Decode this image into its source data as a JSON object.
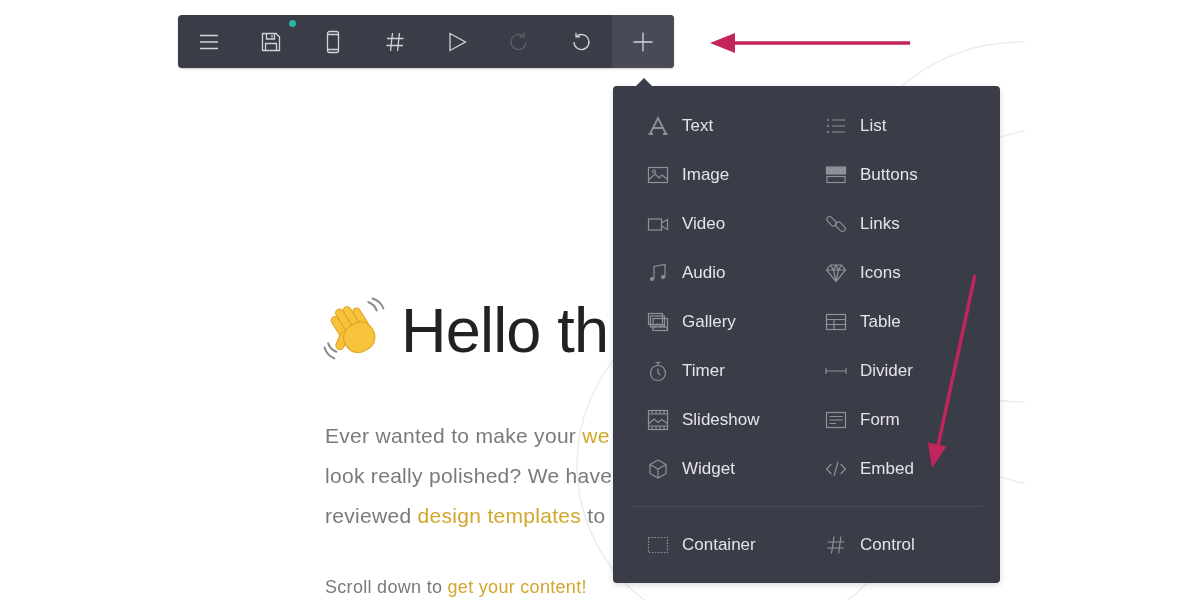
{
  "toolbar": {
    "buttons": [
      {
        "selected": false,
        "disabled": false,
        "dot": false
      },
      {
        "selected": false,
        "disabled": false,
        "dot": true
      },
      {
        "selected": false,
        "disabled": false,
        "dot": false
      },
      {
        "selected": false,
        "disabled": false,
        "dot": false
      },
      {
        "selected": false,
        "disabled": false,
        "dot": false
      },
      {
        "selected": false,
        "disabled": true,
        "dot": false
      },
      {
        "selected": false,
        "disabled": false,
        "dot": false
      },
      {
        "selected": true,
        "disabled": false,
        "dot": false
      }
    ]
  },
  "heading": "Hello th",
  "intro": {
    "lines": [
      [
        {
          "kind": "text",
          "text": "Ever wanted to make your "
        },
        {
          "kind": "link",
          "text": "we"
        }
      ],
      [
        {
          "kind": "text",
          "text": "look really polished? We have"
        }
      ],
      [
        {
          "kind": "text",
          "text": "reviewed "
        },
        {
          "kind": "link",
          "text": "design templates"
        },
        {
          "kind": "text",
          "text": " to"
        }
      ]
    ]
  },
  "scroll_hint": [
    {
      "kind": "text",
      "text": "Scroll down to "
    },
    {
      "kind": "link",
      "text": "get your content!"
    }
  ],
  "insert_menu": {
    "items": [
      {
        "label": "Text"
      },
      {
        "label": "List"
      },
      {
        "label": "Image"
      },
      {
        "label": "Buttons"
      },
      {
        "label": "Video"
      },
      {
        "label": "Links"
      },
      {
        "label": "Audio"
      },
      {
        "label": "Icons"
      },
      {
        "label": "Gallery"
      },
      {
        "label": "Table"
      },
      {
        "label": "Timer"
      },
      {
        "label": "Divider"
      },
      {
        "label": "Slideshow"
      },
      {
        "label": "Form"
      },
      {
        "label": "Widget"
      },
      {
        "label": "Embed"
      }
    ],
    "footer_items": [
      {
        "label": "Container"
      },
      {
        "label": "Control"
      }
    ]
  }
}
